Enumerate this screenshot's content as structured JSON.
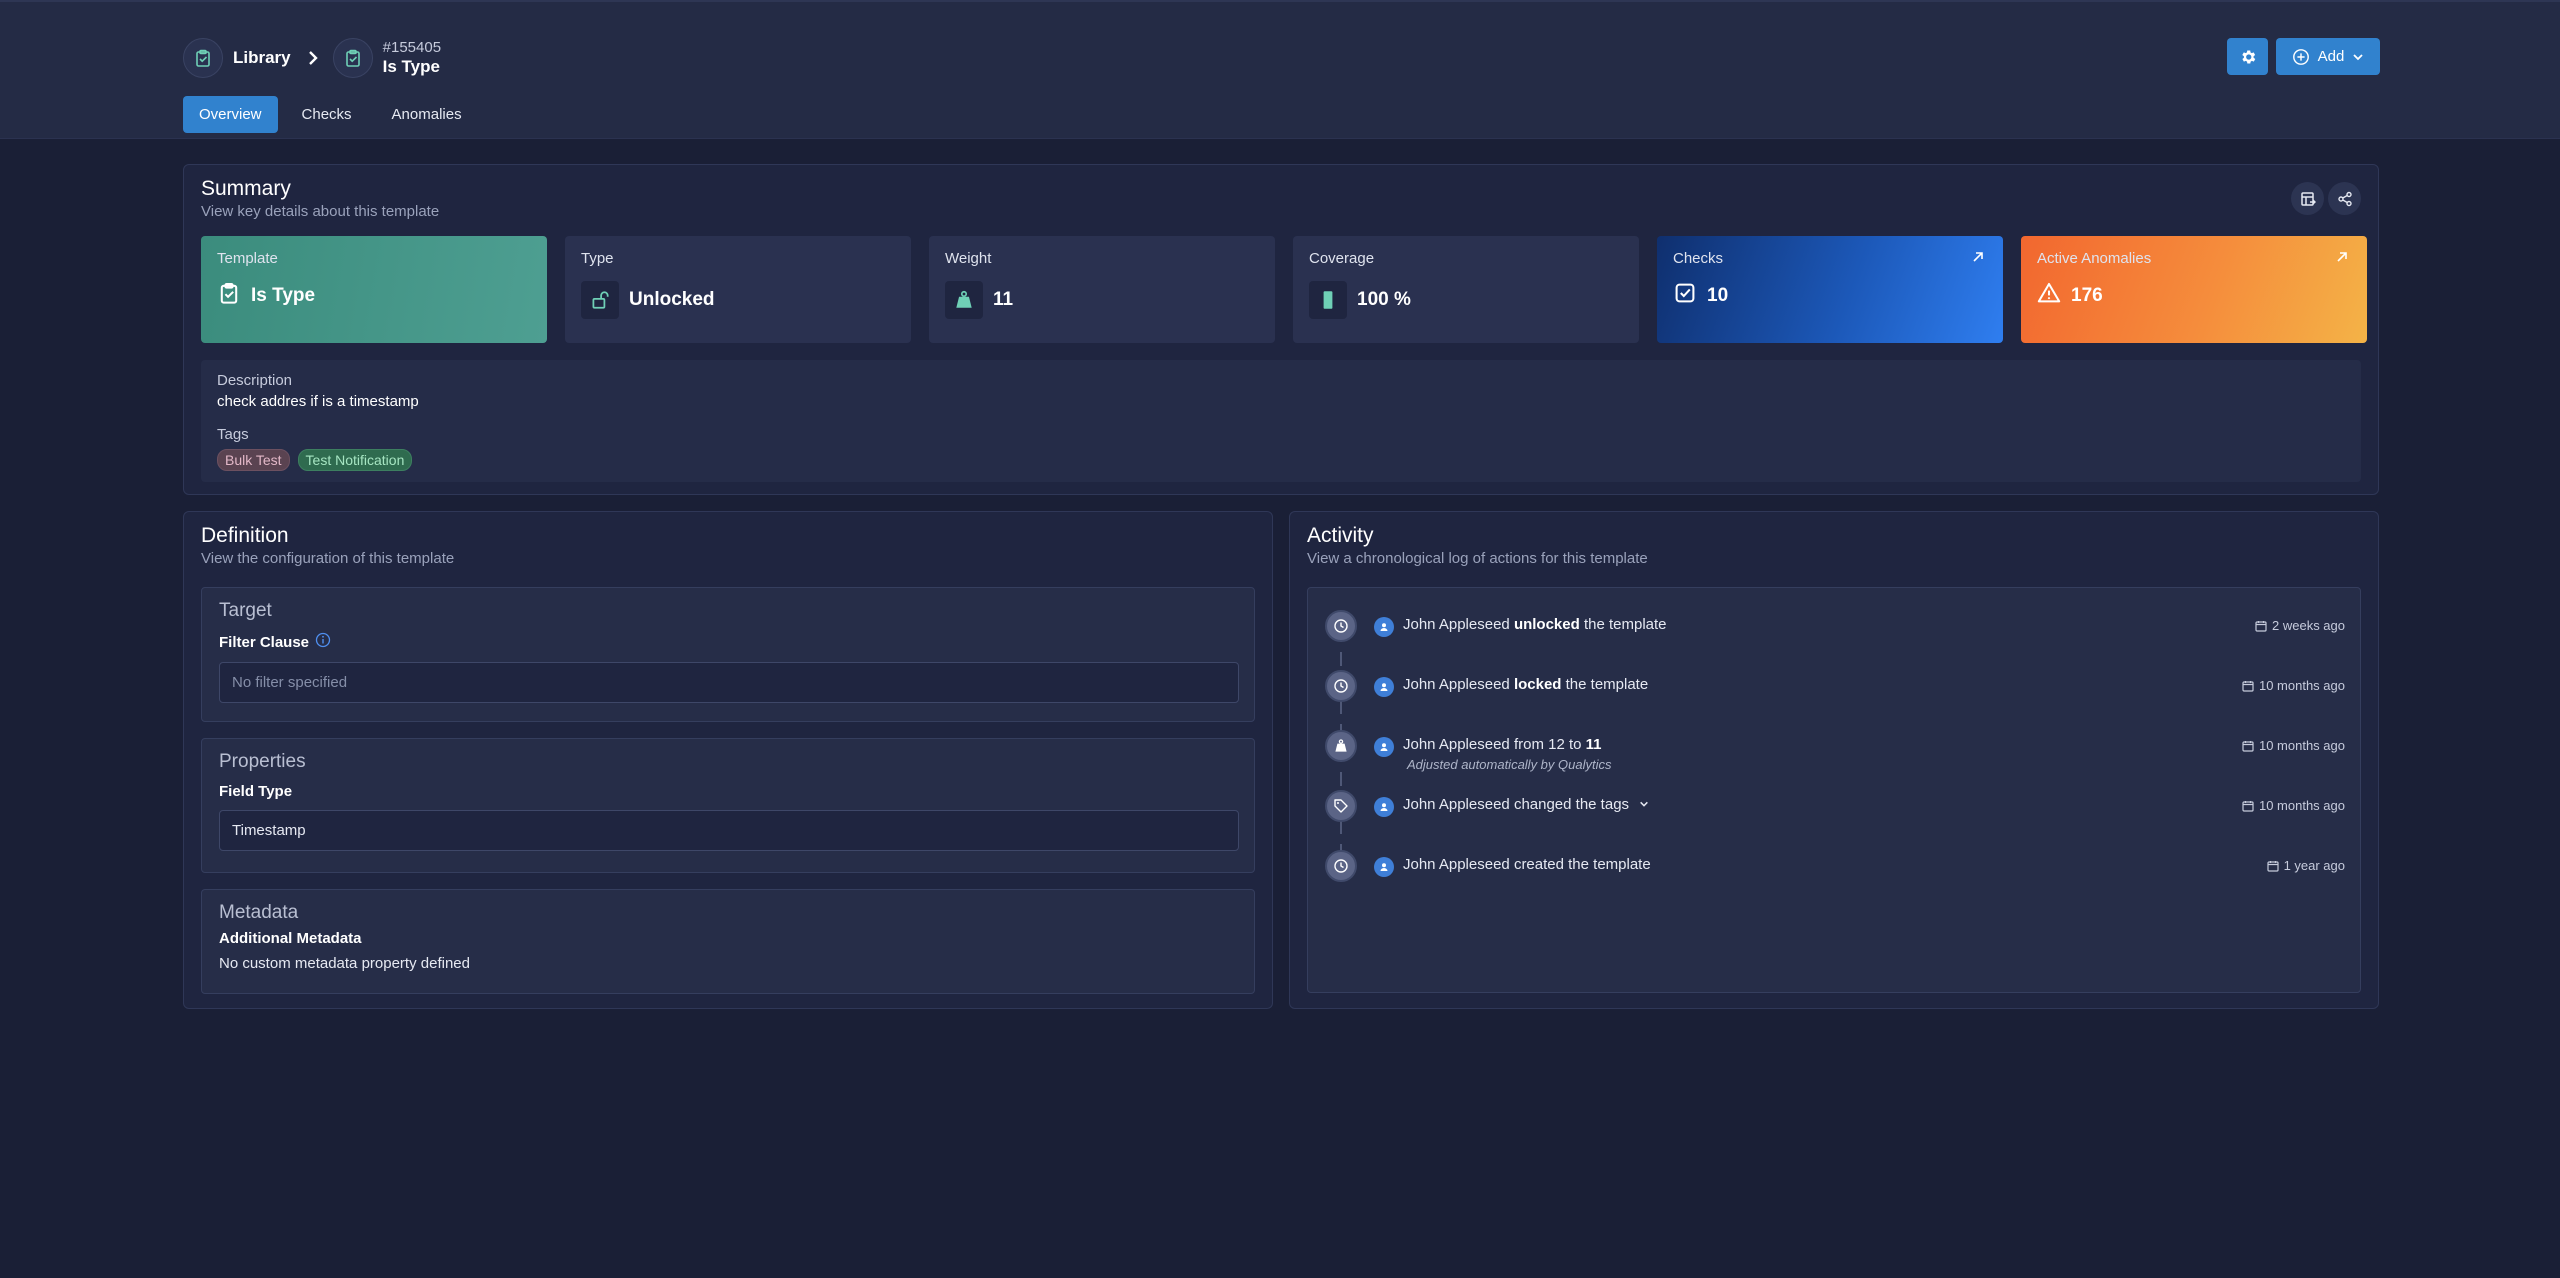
{
  "breadcrumb": {
    "root_label": "Library",
    "current_id": "#155405",
    "current_name": "Is Type"
  },
  "toolbar": {
    "add_label": "Add"
  },
  "tabs": [
    {
      "label": "Overview",
      "active": true
    },
    {
      "label": "Checks",
      "active": false
    },
    {
      "label": "Anomalies",
      "active": false
    }
  ],
  "summary": {
    "title": "Summary",
    "subtitle": "View key details about this template",
    "cards": {
      "template": {
        "label": "Template",
        "value": "Is Type"
      },
      "type": {
        "label": "Type",
        "value": "Unlocked"
      },
      "weight": {
        "label": "Weight",
        "value": "11"
      },
      "coverage": {
        "label": "Coverage",
        "value": "100 %"
      },
      "checks": {
        "label": "Checks",
        "value": "10"
      },
      "anomalies": {
        "label": "Active Anomalies",
        "value": "176"
      }
    },
    "description_label": "Description",
    "description": "check addres if is a timestamp",
    "tags_label": "Tags",
    "tags": [
      "Bulk Test",
      "Test Notification"
    ]
  },
  "definition": {
    "title": "Definition",
    "subtitle": "View the configuration of this template",
    "target": {
      "title": "Target",
      "filter_label": "Filter Clause",
      "filter_placeholder": "No filter specified"
    },
    "properties": {
      "title": "Properties",
      "field_type_label": "Field Type",
      "field_type_value": "Timestamp"
    },
    "metadata": {
      "title": "Metadata",
      "label": "Additional Metadata",
      "value": "No custom metadata property defined"
    }
  },
  "activity": {
    "title": "Activity",
    "subtitle": "View a chronological log of actions for this template",
    "items": [
      {
        "icon": "clock-icon",
        "user": "John Appleseed",
        "action": "unlocked",
        "suffix": "the template",
        "time": "2 weeks ago"
      },
      {
        "icon": "clock-icon",
        "user": "John Appleseed",
        "action": "locked",
        "suffix": "the template",
        "time": "10 months ago"
      },
      {
        "icon": "weight-icon",
        "user": "John Appleseed",
        "text": "from 12 to",
        "value": "11",
        "note": "Adjusted automatically by Qualytics",
        "time": "10 months ago"
      },
      {
        "icon": "tag-icon",
        "user": "John Appleseed",
        "text": "changed the tags",
        "time": "10 months ago"
      },
      {
        "icon": "clock-icon",
        "user": "John Appleseed",
        "text": "created the template",
        "time": "1 year ago"
      }
    ]
  },
  "colors": {
    "background": "#1a1f36",
    "accent": "#3182ce",
    "template_card": "#3b8c7d",
    "checks_card": "#1c58b8",
    "anomalies_card": "#f58d3c"
  }
}
